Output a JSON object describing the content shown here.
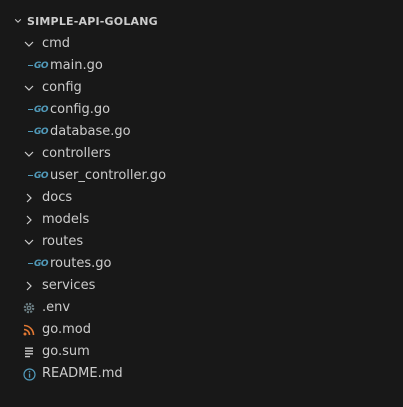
{
  "explorer": {
    "root_label": "SIMPLE-API-GOLANG",
    "items": [
      {
        "type": "folder",
        "label": "cmd",
        "expanded": true,
        "depth": 0,
        "icon": "chevron-down-icon"
      },
      {
        "type": "file",
        "label": "main.go",
        "depth": 1,
        "icon": "go-file-icon"
      },
      {
        "type": "folder",
        "label": "config",
        "expanded": true,
        "depth": 0,
        "icon": "chevron-down-icon"
      },
      {
        "type": "file",
        "label": "config.go",
        "depth": 1,
        "icon": "go-file-icon"
      },
      {
        "type": "file",
        "label": "database.go",
        "depth": 1,
        "icon": "go-file-icon"
      },
      {
        "type": "folder",
        "label": "controllers",
        "expanded": true,
        "depth": 0,
        "icon": "chevron-down-icon"
      },
      {
        "type": "file",
        "label": "user_controller.go",
        "depth": 1,
        "icon": "go-file-icon"
      },
      {
        "type": "folder",
        "label": "docs",
        "expanded": false,
        "depth": 0,
        "icon": "chevron-right-icon"
      },
      {
        "type": "folder",
        "label": "models",
        "expanded": false,
        "depth": 0,
        "icon": "chevron-right-icon"
      },
      {
        "type": "folder",
        "label": "routes",
        "expanded": true,
        "depth": 0,
        "icon": "chevron-down-icon"
      },
      {
        "type": "file",
        "label": "routes.go",
        "depth": 1,
        "icon": "go-file-icon"
      },
      {
        "type": "folder",
        "label": "services",
        "expanded": false,
        "depth": 0,
        "icon": "chevron-right-icon"
      },
      {
        "type": "file",
        "label": ".env",
        "depth": 0,
        "icon": "gear-icon"
      },
      {
        "type": "file",
        "label": "go.mod",
        "depth": 0,
        "icon": "rss-icon"
      },
      {
        "type": "file",
        "label": "go.sum",
        "depth": 0,
        "icon": "lines-icon"
      },
      {
        "type": "file",
        "label": "README.md",
        "depth": 0,
        "icon": "info-icon"
      }
    ]
  },
  "colors": {
    "background": "#181818",
    "text": "#cccccc",
    "go_icon": "#519aba",
    "gear_icon": "#6d8086",
    "rss_icon": "#e37933",
    "lines_icon": "#cccccc",
    "info_icon": "#519aba"
  }
}
